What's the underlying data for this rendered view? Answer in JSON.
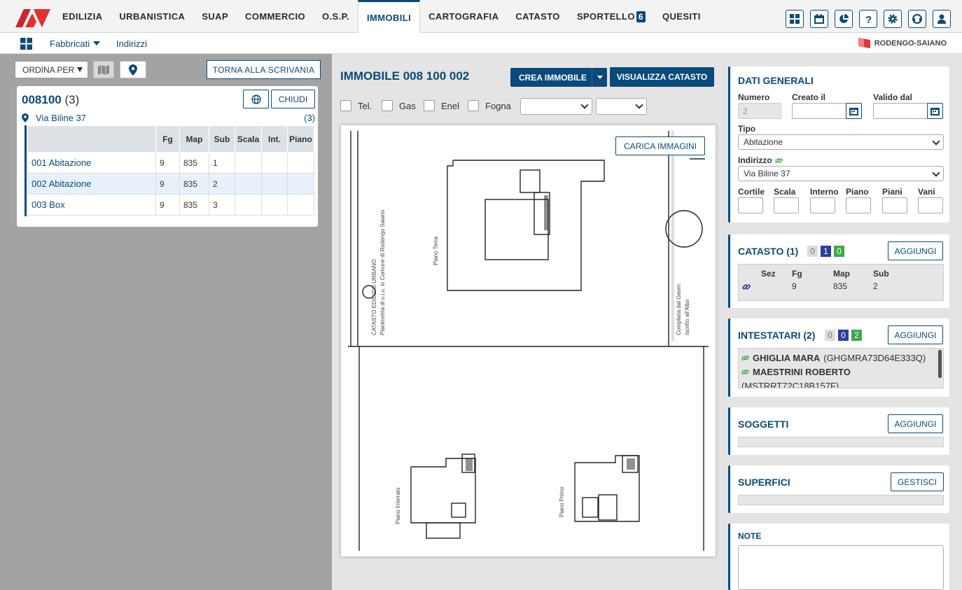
{
  "nav": {
    "items": [
      "EDILIZIA",
      "URBANISTICA",
      "SUAP",
      "COMMERCIO",
      "O.S.P.",
      "IMMOBILI",
      "CARTOGRAFIA",
      "CATASTO",
      "SPORTELLO",
      "QUESITI"
    ],
    "sportello_badge": "6",
    "active": "IMMOBILI",
    "brand_color": "#0a4a7a",
    "logo_color": "#e03030"
  },
  "subnav": {
    "fabbricati": "Fabbricati",
    "indirizzi": "Indirizzi",
    "comune": "RODENGO-SAIANO"
  },
  "left": {
    "ordina": "ORDINA PER",
    "torna": "TORNA ALLA SCRIVANIA",
    "group_code": "008100",
    "group_count": "(3)",
    "chiudi": "CHIUDI",
    "address": "Via Biline 37",
    "address_count": "(3)",
    "columns": [
      "",
      "Fg",
      "Map",
      "Sub",
      "Scala",
      "Int.",
      "Piano"
    ],
    "rows": [
      {
        "name": "001 Abitazione",
        "fg": "9",
        "map": "835",
        "sub": "1",
        "scala": "",
        "int": "",
        "piano": ""
      },
      {
        "name": "002 Abitazione",
        "fg": "9",
        "map": "835",
        "sub": "2",
        "scala": "",
        "int": "",
        "piano": ""
      },
      {
        "name": "003 Box",
        "fg": "9",
        "map": "835",
        "sub": "3",
        "scala": "",
        "int": "",
        "piano": ""
      }
    ]
  },
  "center": {
    "title": "IMMOBILE 008 100 002",
    "crea": "CREA IMMOBILE",
    "visualizza": "VISUALIZZA CATASTO",
    "checks": [
      "Tel.",
      "Gas",
      "Enel",
      "Fogna"
    ],
    "carica": "CARICA IMMAGINI"
  },
  "dati": {
    "title": "DATI GENERALI",
    "numero_label": "Numero",
    "numero_value": "2",
    "creato_label": "Creato il",
    "valido_label": "Valido dal",
    "tipo_label": "Tipo",
    "tipo_value": "Abitazione",
    "indirizzo_label": "Indirizzo",
    "indirizzo_value": "Via Biline 37",
    "fields": [
      "Cortile",
      "Scala",
      "Interno",
      "Piano",
      "Piani",
      "Vani"
    ]
  },
  "catasto": {
    "title": "CATASTO (1)",
    "badges": [
      "0",
      "1",
      "0"
    ],
    "aggiungi": "AGGIUNGI",
    "headers": [
      "Sez",
      "Fg",
      "Map",
      "Sub"
    ],
    "row": {
      "sez": "",
      "fg": "9",
      "map": "835",
      "sub": "2"
    }
  },
  "intestatari": {
    "title": "INTESTATARI (2)",
    "badges": [
      "0",
      "0",
      "2"
    ],
    "aggiungi": "AGGIUNGI",
    "people": [
      {
        "name": "GHIGLIA MARA",
        "cf": "(GHGMRA73D64E333Q)"
      },
      {
        "name": "MAESTRINI ROBERTO",
        "cf": "(MSTRRT72C18B157F)"
      }
    ]
  },
  "soggetti": {
    "title": "SOGGETTI",
    "aggiungi": "AGGIUNGI"
  },
  "superfici": {
    "title": "SUPERFICI",
    "gestisci": "GESTISCI"
  },
  "note": {
    "title": "NOTE"
  },
  "badge_colors": {
    "gray": "#cccccc",
    "blue": "#2b3f9e",
    "green": "#3ea84a"
  }
}
